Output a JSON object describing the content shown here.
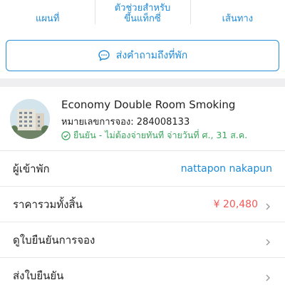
{
  "top_actions": [
    {
      "label_lines": [
        "แผนที่"
      ]
    },
    {
      "label_lines": [
        "ตัวช่วยสำหรับ",
        "ขึ้นแท็กซี่"
      ]
    },
    {
      "label_lines": [
        "เส้นทาง"
      ]
    }
  ],
  "ask": {
    "label": "ส่งคำถามถึงที่พัก",
    "icon": "chat-bubble-icon"
  },
  "booking": {
    "room_name": "Economy Double Room Smoking",
    "booking_no": "หมายเลขการจอง: 284008133",
    "confirm_text": "ยืนยัน - ไม่ต้องจ่ายทันที จ่ายวันที่ ศ., 31 ส.ค."
  },
  "rows": {
    "guest": {
      "label": "ผู้เข้าพัก",
      "value": "nattapon nakapun"
    },
    "price": {
      "label": "ราคารวมทั้งสิ้น",
      "value": "¥ 20,480"
    },
    "view_confirmation": {
      "label": "ดูใบยืนยันการจอง"
    },
    "send_confirmation": {
      "label": "ส่งใบยืนยัน"
    }
  },
  "colors": {
    "accent": "#1f8ad6",
    "success": "#3ba55d",
    "price": "#f25757"
  }
}
